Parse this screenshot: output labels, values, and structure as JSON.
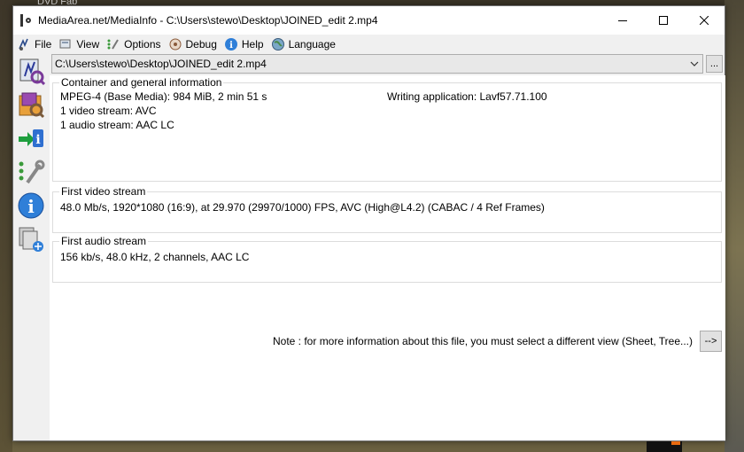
{
  "desktop": {
    "top_label": "DVD Fab"
  },
  "window": {
    "title": "MediaArea.net/MediaInfo - C:\\Users\\stewo\\Desktop\\JOINED_edit 2.mp4",
    "controls": [
      "minimize-icon",
      "maximize-icon",
      "close-icon"
    ]
  },
  "menu": [
    {
      "label": "File",
      "icon": "file-icon"
    },
    {
      "label": "View",
      "icon": "view-icon"
    },
    {
      "label": "Options",
      "icon": "options-icon"
    },
    {
      "label": "Debug",
      "icon": "debug-icon"
    },
    {
      "label": "Help",
      "icon": "help-icon"
    },
    {
      "label": "Language",
      "icon": "language-icon"
    }
  ],
  "sidebar": [
    "open-file-icon",
    "open-folder-icon",
    "export-icon",
    "preferences-icon",
    "about-icon",
    "knowledge-base-icon"
  ],
  "file_select": {
    "value": "C:\\Users\\stewo\\Desktop\\JOINED_edit 2.mp4",
    "browse_label": "..."
  },
  "container": {
    "title": "Container and general information",
    "lines": [
      "MPEG-4 (Base Media): 984 MiB, 2 min 51 s",
      "1 video stream: AVC",
      "1 audio stream: AAC LC"
    ],
    "writing_application": "Writing application: Lavf57.71.100"
  },
  "video": {
    "title": "First video stream",
    "line": "48.0 Mb/s, 1920*1080 (16:9), at 29.970 (29970/1000) FPS, AVC (High@L4.2) (CABAC / 4 Ref Frames)"
  },
  "audio": {
    "title": "First audio stream",
    "line": "156 kb/s, 48.0 kHz, 2 channels, AAC LC"
  },
  "note": {
    "text": "Note : for more information about this file, you must select a different view (Sheet, Tree...)",
    "button_label": "-->"
  }
}
